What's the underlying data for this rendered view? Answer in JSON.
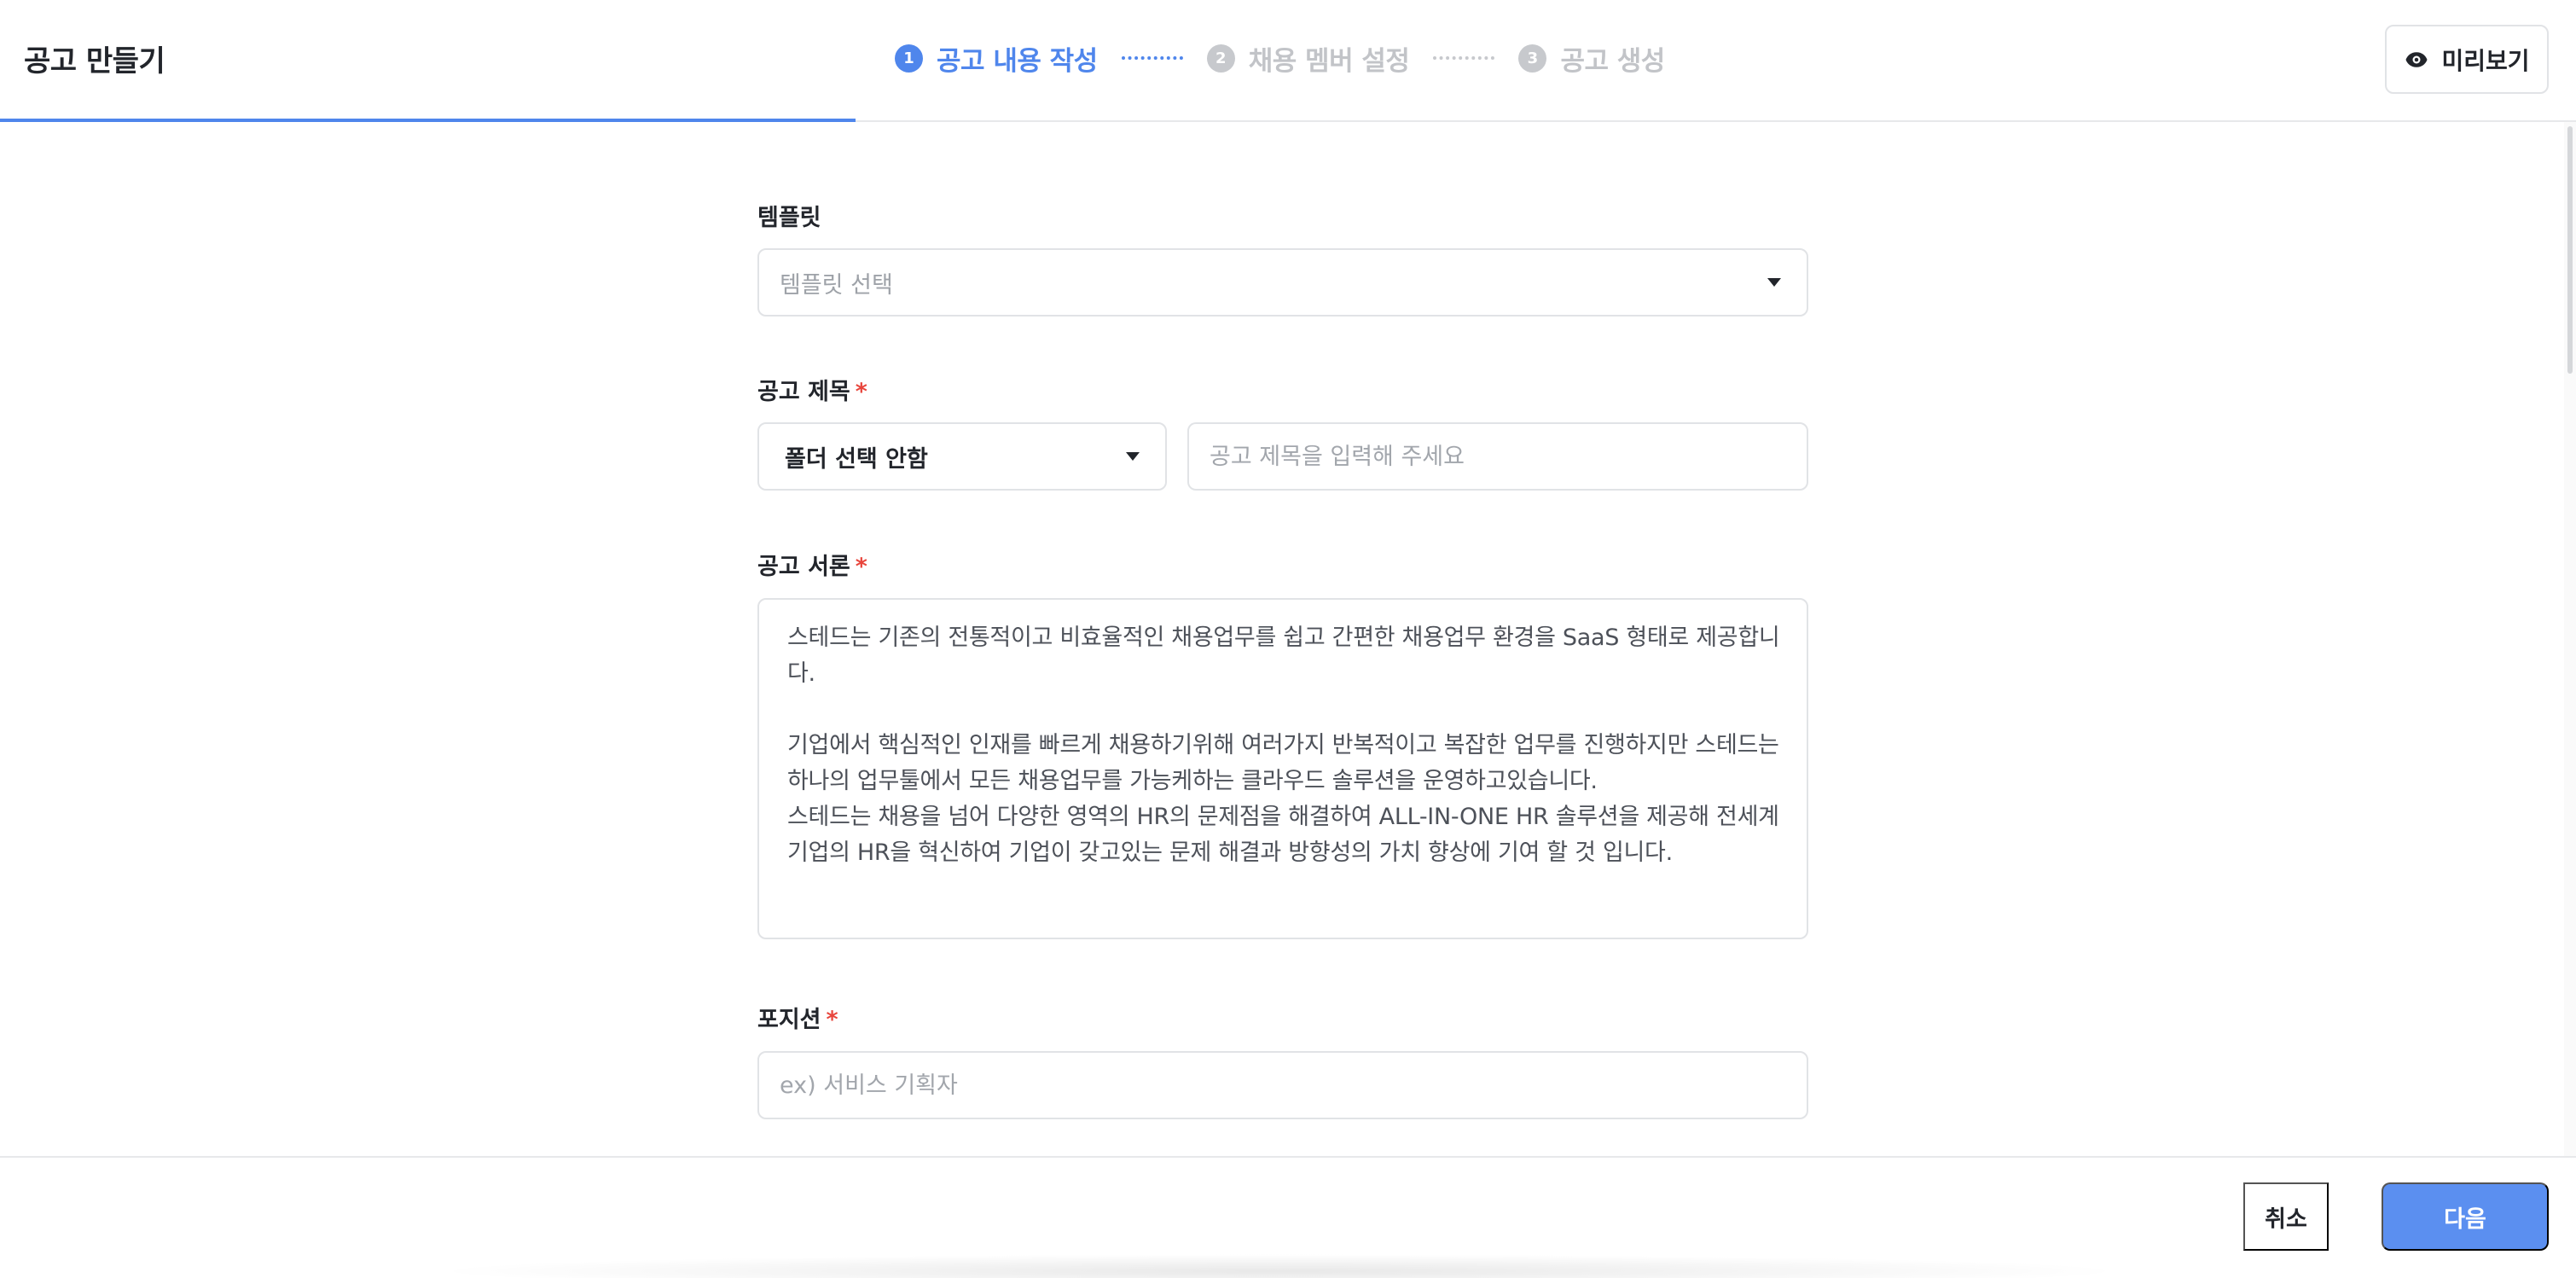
{
  "header": {
    "title": "공고 만들기",
    "steps": [
      {
        "num": "1",
        "label": "공고 내용 작성"
      },
      {
        "num": "2",
        "label": "채용 멤버 설정"
      },
      {
        "num": "3",
        "label": "공고 생성"
      }
    ],
    "preview_label": "미리보기"
  },
  "form": {
    "template": {
      "label": "템플릿",
      "placeholder": "템플릿 선택"
    },
    "title": {
      "label": "공고 제목",
      "required_mark": "*",
      "folder_value": "폴더 선택 안함",
      "input_placeholder": "공고 제목을 입력해 주세요"
    },
    "intro": {
      "label": "공고 서론",
      "required_mark": "*",
      "paragraph1": "스테드는 기존의 전통적이고 비효율적인 채용업무를 쉽고 간편한 채용업무 환경을 SaaS 형태로 제공합니다.",
      "paragraph2": "기업에서 핵심적인 인재를 빠르게 채용하기위해 여러가지 반복적이고 복잡한 업무를 진행하지만 스테드는 하나의 업무툴에서 모든 채용업무를 가능케하는 클라우드 솔루션을 운영하고있습니다.",
      "paragraph3": "스테드는 채용을 넘어 다양한 영역의 HR의 문제점을 해결하여 ALL-IN-ONE HR 솔루션을 제공해 전세계 기업의 HR을 혁신하여 기업이 갖고있는 문제 해결과 방향성의 가치 향상에 기여 할 것 입니다."
    },
    "position": {
      "label": "포지션",
      "required_mark": "*",
      "placeholder": "ex) 서비스 기획자"
    }
  },
  "footer": {
    "cancel_label": "취소",
    "next_label": "다음"
  },
  "colors": {
    "accent": "#4f86ec",
    "required": "#e8453c",
    "inactive_step": "#c2c4c8"
  }
}
